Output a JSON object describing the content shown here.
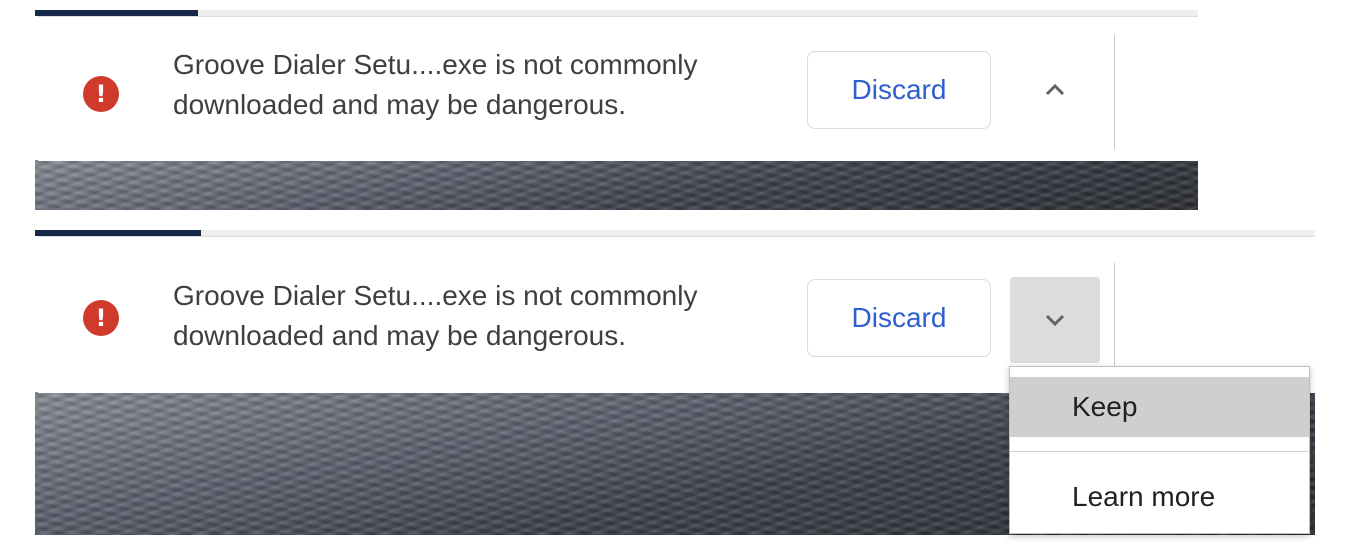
{
  "downloads": [
    {
      "message": "Groove Dialer Setu....exe is not commonly downloaded and may be dangerous.",
      "discard_label": "Discard",
      "toggle_icon": "chevron-up-icon",
      "warning_icon": "!",
      "progress": 0.14
    },
    {
      "message": "Groove Dialer Setu....exe is not commonly downloaded and may be dangerous.",
      "discard_label": "Discard",
      "toggle_icon": "chevron-down-icon",
      "warning_icon": "!",
      "progress": 0.13
    }
  ],
  "context_menu": {
    "items": [
      {
        "label": "Keep",
        "highlighted": true
      },
      {
        "label": "Learn more",
        "highlighted": false
      }
    ]
  },
  "colors": {
    "warning": "#d03a2b",
    "link_blue": "#2f5fcf",
    "progress": "#16284a"
  }
}
